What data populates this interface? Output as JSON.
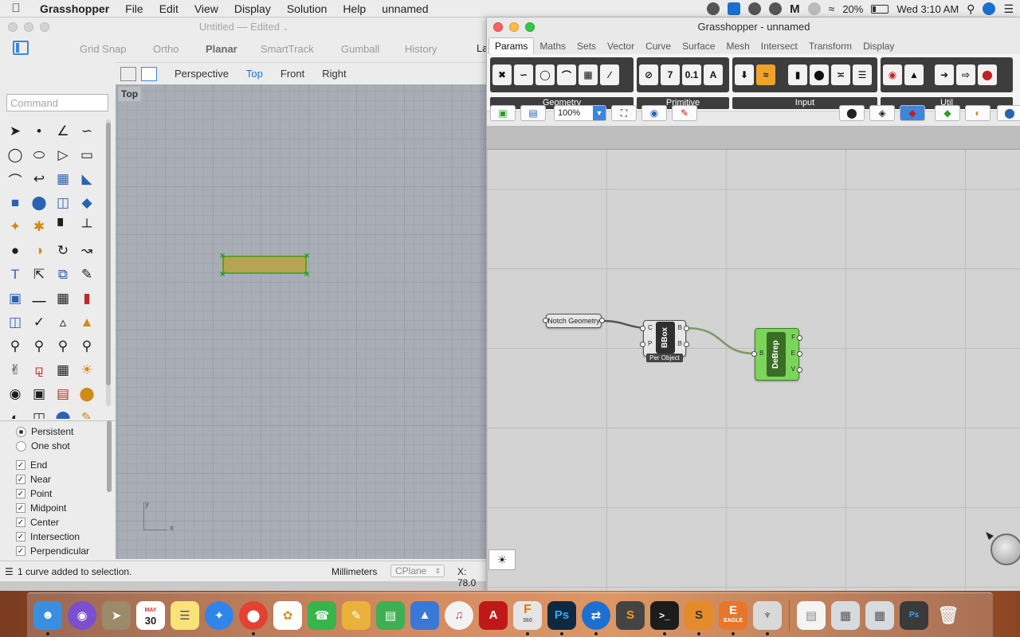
{
  "menubar": {
    "app_name": "Grasshopper",
    "items": [
      "File",
      "Edit",
      "View",
      "Display",
      "Solution",
      "Help",
      "unnamed"
    ],
    "battery": "20%",
    "clock": "Wed 3:10 AM"
  },
  "rhino": {
    "title": "Untitled",
    "title_status": "— Edited",
    "toolbar_buttons": [
      "Grid Snap",
      "Ortho",
      "Planar",
      "SmartTrack",
      "Gumball",
      "History"
    ],
    "viewport_tabs": [
      "Perspective",
      "Top",
      "Front",
      "Right"
    ],
    "active_tab": "Top",
    "right_clip": "La",
    "command_placeholder": "Command",
    "viewport_label": "Top",
    "axis_y": "y",
    "axis_x": "x",
    "osnap": {
      "persistent": "Persistent",
      "one_shot": "One shot",
      "options": [
        "End",
        "Near",
        "Point",
        "Midpoint",
        "Center",
        "Intersection",
        "Perpendicular"
      ]
    },
    "status": {
      "message": "1 curve added to selection.",
      "units": "Millimeters",
      "cplane": "CPlane",
      "coord": "X: 78.0"
    }
  },
  "grasshopper": {
    "title": "Grasshopper - unnamed",
    "tabs": [
      "Params",
      "Maths",
      "Sets",
      "Vector",
      "Curve",
      "Surface",
      "Mesh",
      "Intersect",
      "Transform",
      "Display"
    ],
    "active_tab": "Params",
    "ribbon_groups": [
      "Geometry",
      "Primitive",
      "Input",
      "Util"
    ],
    "primitive_icons": [
      "7",
      "0.1",
      "A"
    ],
    "zoom": "100%",
    "components": {
      "notch": {
        "label": "Notch Geometry"
      },
      "bbox": {
        "name": "BBox",
        "inputs": [
          "C",
          "P"
        ],
        "outputs": [
          "B",
          "B"
        ],
        "flag": "Per Object"
      },
      "debrep": {
        "name": "DeBrep",
        "inputs": [
          "B"
        ],
        "outputs": [
          "F",
          "E",
          "V"
        ]
      }
    }
  },
  "dock": {
    "calendar_month": "MAY",
    "calendar_day": "30",
    "fusion_label": "360",
    "eagle_label": "EAGLE"
  },
  "colors": {
    "accent": "#1d73d8",
    "gh_component_green": "#7cd55b",
    "rect_fill": "#b6a54d",
    "grip_green": "#1b9a1b"
  }
}
